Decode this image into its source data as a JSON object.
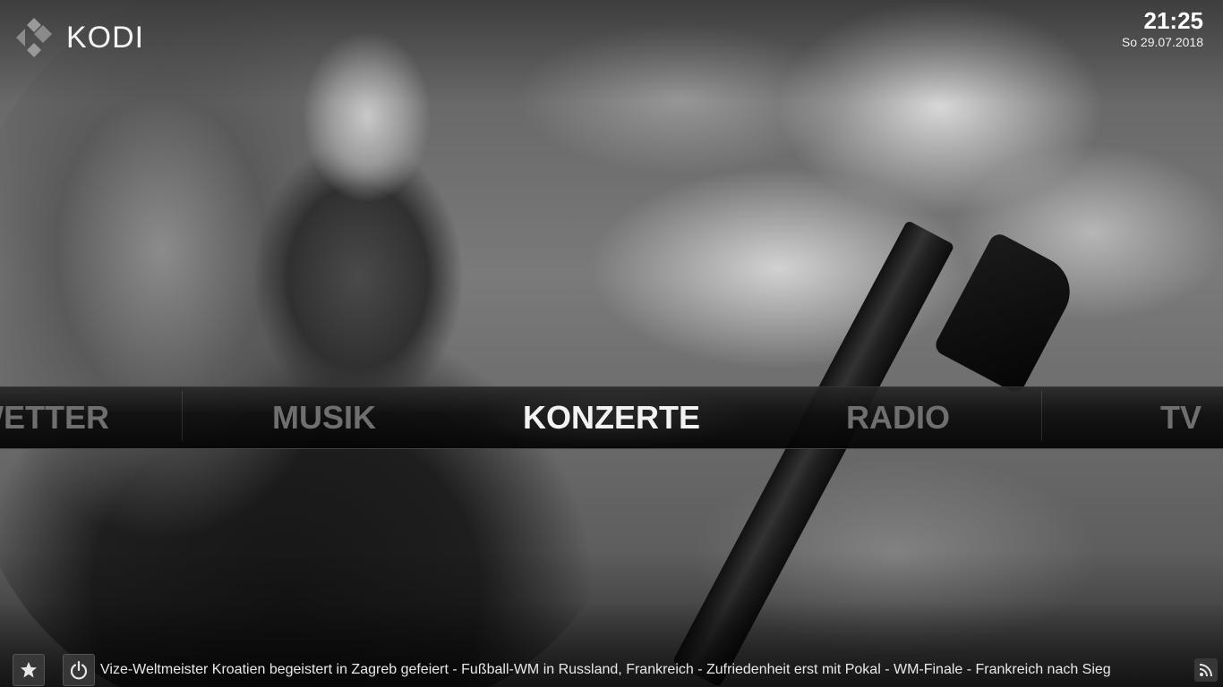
{
  "header": {
    "logo_text": "KODI",
    "time": "21:25",
    "date": "So  29.07.2018"
  },
  "menu": {
    "items": [
      {
        "label": "WETTER",
        "focused": false
      },
      {
        "label": "MUSIK",
        "focused": false
      },
      {
        "label": "KONZERTE",
        "focused": true
      },
      {
        "label": "RADIO",
        "focused": false
      },
      {
        "label": "TV",
        "focused": false
      }
    ]
  },
  "footer": {
    "favourites_icon": "star-icon",
    "power_icon": "power-icon",
    "rss_icon": "rss-icon",
    "ticker_text": "Vize-Weltmeister Kroatien begeistert in Zagreb gefeiert - Fußball-WM in Russland, Frankreich - Zufriedenheit erst mit Pokal - WM-Finale - Frankreich nach Sieg"
  },
  "colors": {
    "focused_text": "#f2f2f2",
    "unfocused_text": "#6f6f6f",
    "menu_bar": "#0f0f0f"
  }
}
